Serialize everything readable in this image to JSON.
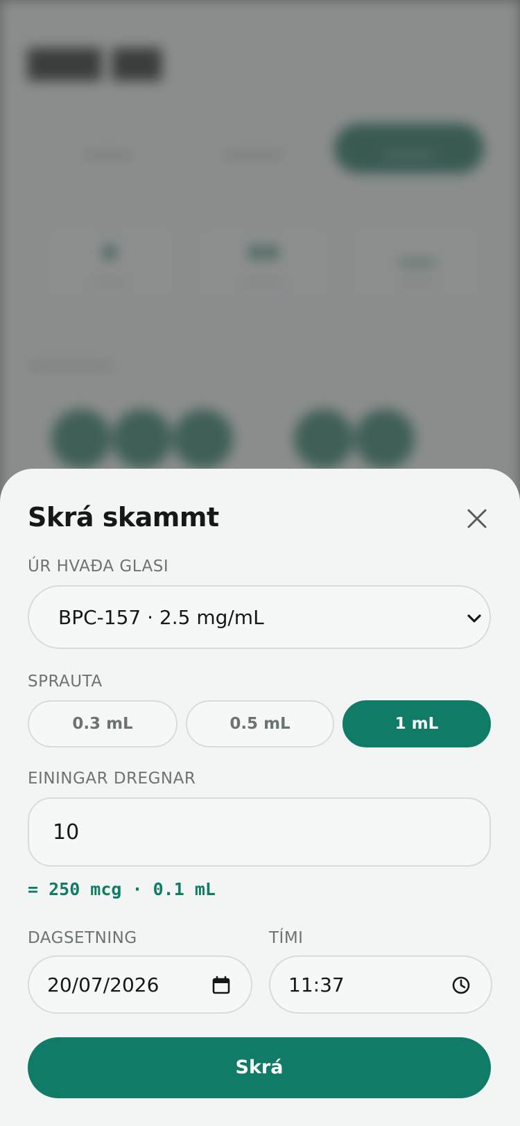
{
  "sheet": {
    "title": "Skrá skammt",
    "vial_label": "ÚR HVAÐA GLASI",
    "vial_value": "BPC-157 · 2.5 mg/mL",
    "syringe_label": "SPRAUTA",
    "syringe_options": [
      "0.3 mL",
      "0.5 mL",
      "1 mL"
    ],
    "syringe_selected": "1 mL",
    "units_label": "EININGAR DREGNAR",
    "units_value": "10",
    "calculated": "= 250 mcg · 0.1 mL",
    "date_label": "DAGSETNING",
    "date_value": "20/07/2026",
    "time_label": "TÍMI",
    "time_value": "11:37",
    "submit_label": "Skrá"
  },
  "icons": {
    "close": "close-icon",
    "chevron": "chevron-down-icon",
    "calendar": "calendar-icon",
    "clock": "clock-icon"
  },
  "colors": {
    "accent": "#107c67",
    "sheet_background": "#f3f5f4",
    "text_primary": "#141917",
    "text_muted": "#6b7470",
    "border": "#d6dcd9"
  }
}
